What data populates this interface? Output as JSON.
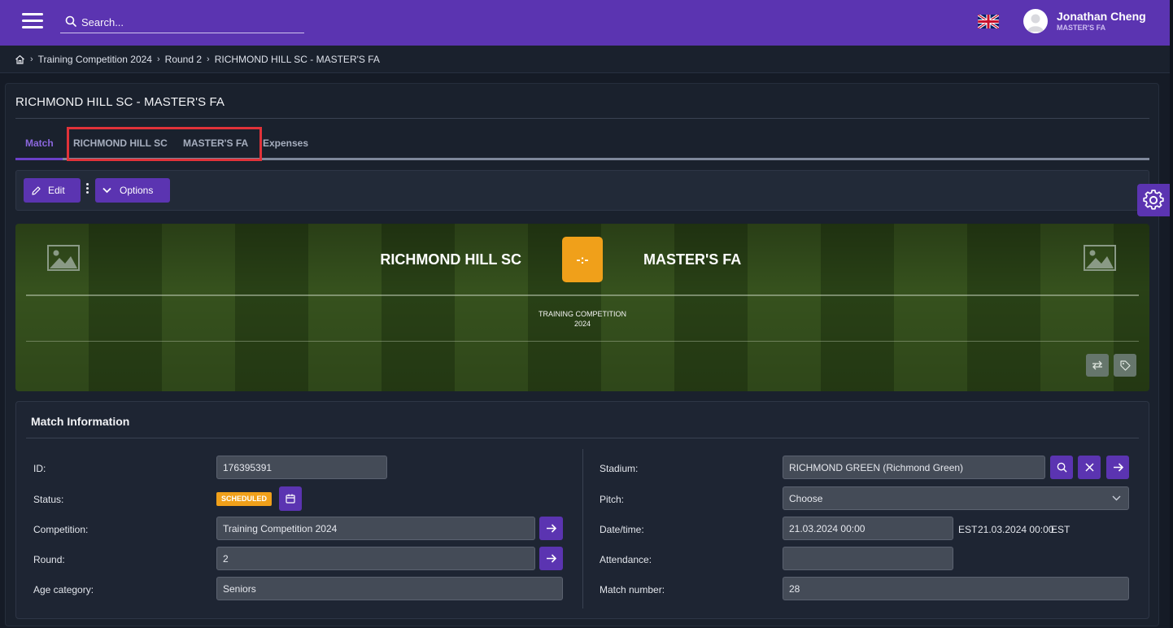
{
  "search": {
    "placeholder": "Search..."
  },
  "user": {
    "name": "Jonathan Cheng",
    "organization": "MASTER'S FA"
  },
  "breadcrumb": {
    "items": [
      "Training Competition 2024",
      "Round 2",
      "RICHMOND HILL SC - MASTER'S FA"
    ]
  },
  "page": {
    "title": "RICHMOND HILL SC - MASTER'S FA"
  },
  "tabs": [
    "Match",
    "RICHMOND HILL SC",
    "MASTER'S FA",
    "Expenses"
  ],
  "toolbar": {
    "edit_label": "Edit",
    "options_label": "Options"
  },
  "banner": {
    "home_team": "RICHMOND HILL SC",
    "away_team": "MASTER'S FA",
    "score": "-:-",
    "competition_line1": "TRAINING COMPETITION",
    "competition_line2": "2024"
  },
  "match_info": {
    "title": "Match Information",
    "left": {
      "id_label": "ID:",
      "id_value": "176395391",
      "status_label": "Status:",
      "status_value": "SCHEDULED",
      "competition_label": "Competition:",
      "competition_value": "Training Competition 2024",
      "round_label": "Round:",
      "round_value": "2",
      "age_label": "Age category:",
      "age_value": "Seniors"
    },
    "right": {
      "stadium_label": "Stadium:",
      "stadium_value": "RICHMOND GREEN (Richmond Green)",
      "pitch_label": "Pitch:",
      "pitch_value": "Choose",
      "datetime_label": "Date/time:",
      "datetime_value": "21.03.2024 00:00",
      "tz1": "EST",
      "datetime_alt": "21.03.2024 00:00",
      "tz2": "EST",
      "attendance_label": "Attendance:",
      "attendance_value": "",
      "match_number_label": "Match number:",
      "match_number_value": "28"
    }
  },
  "colors": {
    "brand": "#5b34b1",
    "status": "#f0a01a",
    "highlight": "#e13239"
  }
}
